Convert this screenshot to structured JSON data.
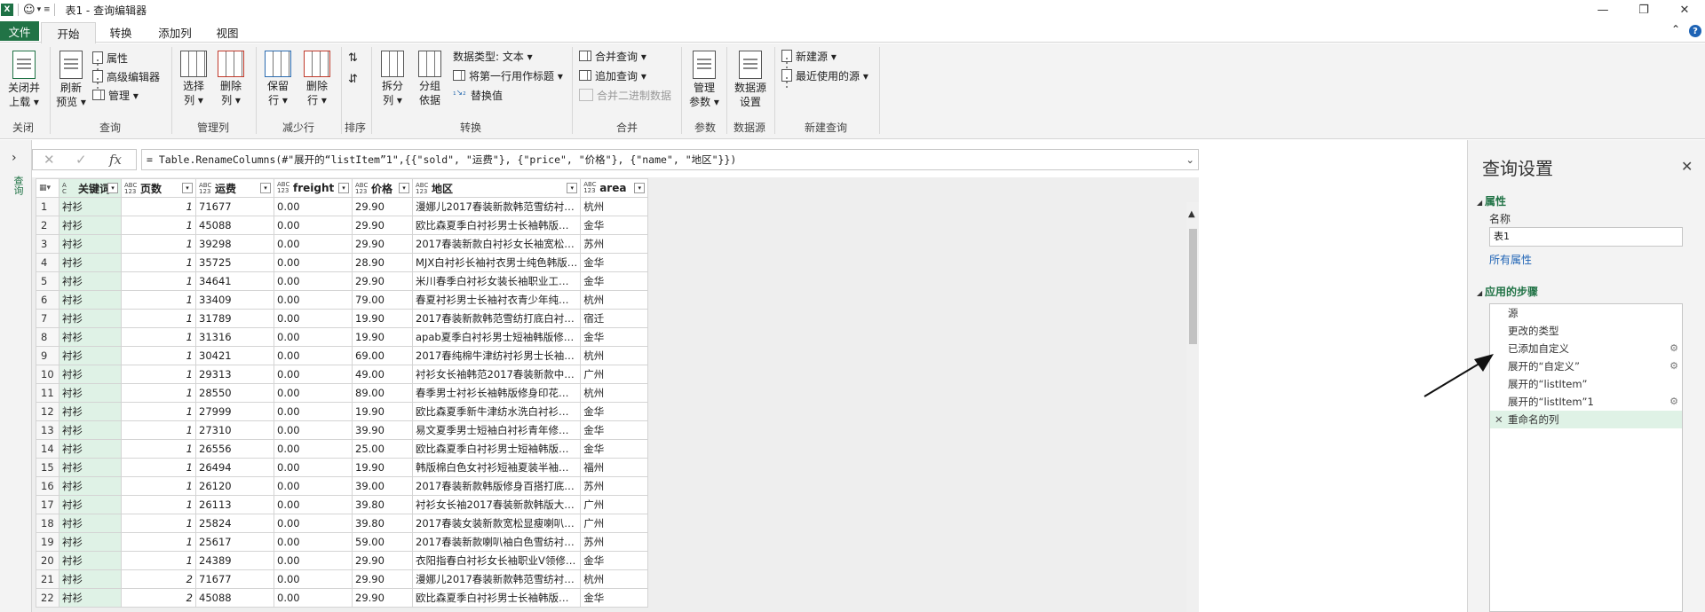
{
  "window": {
    "title": "表1 - 查询编辑器",
    "icon_letter": "X"
  },
  "tabs": [
    {
      "label": "文件"
    },
    {
      "label": "开始"
    },
    {
      "label": "转换"
    },
    {
      "label": "添加列"
    },
    {
      "label": "视图"
    }
  ],
  "ribbon": {
    "close_apply": "关闭并\n上载 ▾",
    "refresh": "刷新\n预览 ▾",
    "properties": "属性",
    "advanced_editor": "高级编辑器",
    "manage": "管理 ▾",
    "choose_cols": "选择\n列 ▾",
    "remove_cols": "删除\n列 ▾",
    "keep_rows": "保留\n行 ▾",
    "remove_rows": "删除\n行 ▾",
    "split_col": "拆分\n列 ▾",
    "group_by": "分组\n依据",
    "data_type": "数据类型: 文本 ▾",
    "first_row_header": "将第一行用作标题 ▾",
    "replace_values": "替换值",
    "merge_queries": "合并查询 ▾",
    "append_queries": "追加查询 ▾",
    "combine_binaries": "合并二进制数据",
    "manage_params": "管理\n参数 ▾",
    "datasource_settings": "数据源\n设置",
    "new_source": "新建源 ▾",
    "recent_sources": "最近使用的源 ▾",
    "groups": {
      "close": "关闭",
      "query": "查询",
      "manage_cols": "管理列",
      "reduce_rows": "减少行",
      "sort": "排序",
      "transform": "转换",
      "combine": "合并",
      "params": "参数",
      "datasource": "数据源",
      "new_query": "新建查询"
    }
  },
  "formula": "= Table.RenameColumns(#\"展开的“listItem”1\",{{\"sold\", \"运费\"}, {\"price\", \"价格\"}, {\"name\", \"地区\"}})",
  "left_nav_label": "查询",
  "columns": [
    {
      "type": "ABC",
      "name": "关键词",
      "type_top": "A",
      "type_bot": "C"
    },
    {
      "type": "ABC 123",
      "name": "页数",
      "type_top": "ABC",
      "type_bot": "123"
    },
    {
      "type": "ABC 123",
      "name": "运费",
      "type_top": "ABC",
      "type_bot": "123"
    },
    {
      "type": "ABC 123",
      "name": "freight",
      "type_top": "ABC",
      "type_bot": "123"
    },
    {
      "type": "ABC 123",
      "name": "价格",
      "type_top": "ABC",
      "type_bot": "123"
    },
    {
      "type": "ABC 123",
      "name": "地区",
      "type_top": "ABC",
      "type_bot": "123"
    },
    {
      "type": "ABC 123",
      "name": "area",
      "type_top": "ABC",
      "type_bot": "123"
    }
  ],
  "rows": [
    [
      "衬衫",
      "1",
      "71677",
      "0.00",
      "29.90",
      "漫娜儿2017春装新款韩范雪纺衬…",
      "杭州"
    ],
    [
      "衬衫",
      "1",
      "45088",
      "0.00",
      "29.90",
      "欧比森夏季白衬衫男士长袖韩版…",
      "金华"
    ],
    [
      "衬衫",
      "1",
      "39298",
      "0.00",
      "29.90",
      "2017春装新款白衬衫女长袖宽松…",
      "苏州"
    ],
    [
      "衬衫",
      "1",
      "35725",
      "0.00",
      "28.90",
      "MJX白衬衫长袖衬衣男士纯色韩版…",
      "金华"
    ],
    [
      "衬衫",
      "1",
      "34641",
      "0.00",
      "29.90",
      "米川春季白衬衫女装长袖职业工…",
      "金华"
    ],
    [
      "衬衫",
      "1",
      "33409",
      "0.00",
      "79.00",
      "春夏衬衫男士长袖衬衣青少年纯…",
      "杭州"
    ],
    [
      "衬衫",
      "1",
      "31789",
      "0.00",
      "19.90",
      "2017春装新款韩范雪纺打底白衬…",
      "宿迁"
    ],
    [
      "衬衫",
      "1",
      "31316",
      "0.00",
      "19.90",
      "apab夏季白衬衫男士短袖韩版修…",
      "金华"
    ],
    [
      "衬衫",
      "1",
      "30421",
      "0.00",
      "69.00",
      "2017春纯棉牛津纺衬衫男士长袖…",
      "杭州"
    ],
    [
      "衬衫",
      "1",
      "29313",
      "0.00",
      "49.00",
      "衬衫女长袖韩范2017春装新款中…",
      "广州"
    ],
    [
      "衬衫",
      "1",
      "28550",
      "0.00",
      "89.00",
      "春季男士衬衫长袖韩版修身印花…",
      "杭州"
    ],
    [
      "衬衫",
      "1",
      "27999",
      "0.00",
      "19.90",
      "欧比森夏季新牛津纺水洗白衬衫…",
      "金华"
    ],
    [
      "衬衫",
      "1",
      "27310",
      "0.00",
      "39.90",
      "易文夏季男士短袖白衬衫青年修…",
      "金华"
    ],
    [
      "衬衫",
      "1",
      "26556",
      "0.00",
      "25.00",
      "欧比森夏季白衬衫男士短袖韩版…",
      "金华"
    ],
    [
      "衬衫",
      "1",
      "26494",
      "0.00",
      "19.90",
      "韩版棉白色女衬衫短袖夏装半袖…",
      "福州"
    ],
    [
      "衬衫",
      "1",
      "26120",
      "0.00",
      "39.00",
      "2017春装新款韩版修身百搭打底…",
      "苏州"
    ],
    [
      "衬衫",
      "1",
      "26113",
      "0.00",
      "39.80",
      "衬衫女长袖2017春装新款韩版大…",
      "广州"
    ],
    [
      "衬衫",
      "1",
      "25824",
      "0.00",
      "39.80",
      "2017春装女装新款宽松显瘦喇叭…",
      "广州"
    ],
    [
      "衬衫",
      "1",
      "25617",
      "0.00",
      "59.00",
      "2017春装新款喇叭袖白色雪纺衬…",
      "苏州"
    ],
    [
      "衬衫",
      "1",
      "24389",
      "0.00",
      "29.90",
      "衣阳指春白衬衫女长袖职业V领修…",
      "金华"
    ],
    [
      "衬衫",
      "2",
      "71677",
      "0.00",
      "29.90",
      "漫娜儿2017春装新款韩范雪纺衬…",
      "杭州"
    ],
    [
      "衬衫",
      "2",
      "45088",
      "0.00",
      "29.90",
      "欧比森夏季白衬衫男士长袖韩版…",
      "金华"
    ]
  ],
  "panel": {
    "title": "查询设置",
    "properties_label": "属性",
    "name_label": "名称",
    "name_value": "表1",
    "all_props_link": "所有属性",
    "steps_label": "应用的步骤",
    "steps": [
      {
        "label": "源",
        "gear": false
      },
      {
        "label": "更改的类型",
        "gear": false
      },
      {
        "label": "已添加自定义",
        "gear": true
      },
      {
        "label": "展开的“自定义”",
        "gear": true
      },
      {
        "label": "展开的“listItem”",
        "gear": false
      },
      {
        "label": "展开的“listItem”1",
        "gear": true
      },
      {
        "label": "重命名的列",
        "gear": false,
        "selected": true
      }
    ]
  },
  "colors": {
    "accent": "#217346",
    "selection": "#dff2e6",
    "link": "#1e63b5"
  }
}
